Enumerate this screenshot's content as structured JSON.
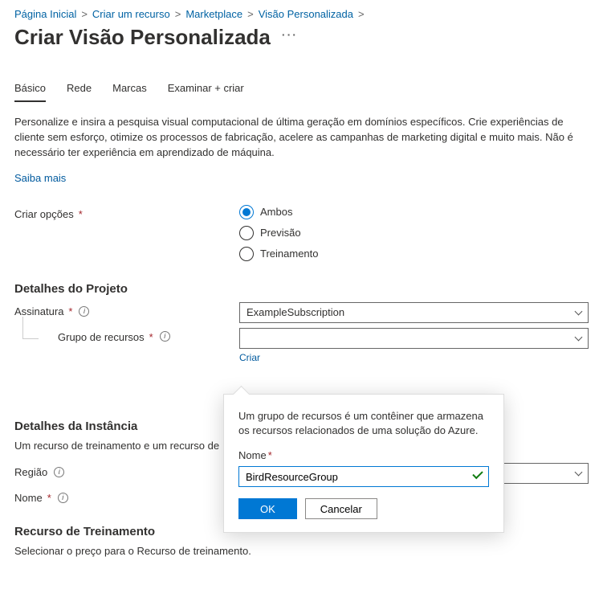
{
  "breadcrumb": [
    "Página Inicial",
    "Criar um recurso",
    "Marketplace",
    "Visão Personalizada"
  ],
  "title": "Criar Visão Personalizada",
  "tabs": [
    "Básico",
    "Rede",
    "Marcas",
    "Examinar + criar"
  ],
  "description": "Personalize e insira a pesquisa visual computacional de última geração em domínios específicos. Crie experiências de cliente sem esforço, otimize os processos de fabricação, acelere as campanhas de marketing digital e muito mais. Não é necessário ter experiência em aprendizado de máquina.",
  "learn_more": "Saiba mais",
  "create_options": {
    "label": "Criar opções",
    "items": [
      "Ambos",
      "Previsão",
      "Treinamento"
    ],
    "selected": 0
  },
  "project": {
    "heading": "Detalhes do Projeto",
    "subscription_label": "Assinatura",
    "subscription_value": "ExampleSubscription",
    "rg_label": "Grupo de recursos",
    "rg_value": "",
    "create_link": "Criar"
  },
  "instance": {
    "heading": "Detalhes da Instância",
    "desc": "Um recurso de treinamento e um recurso de",
    "region_label": "Região",
    "name_label": "Nome"
  },
  "training": {
    "heading": "Recurso de Treinamento",
    "desc": "Selecionar o preço para o Recurso de treinamento."
  },
  "popup": {
    "desc": "Um grupo de recursos é um contêiner que armazena os recursos relacionados de uma solução do Azure.",
    "name_label": "Nome",
    "name_value": "BirdResourceGroup",
    "ok": "OK",
    "cancel": "Cancelar"
  }
}
